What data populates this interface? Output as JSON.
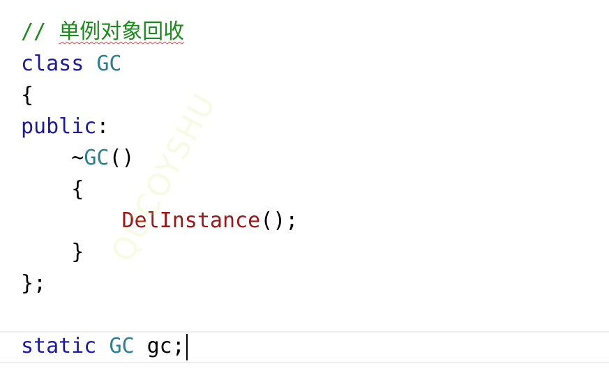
{
  "colors": {
    "comment": "#1a8c1a",
    "keyword": "#1a1aa6",
    "type": "#2b7f8f",
    "function_call": "#a31515",
    "plain": "#000000",
    "watermark": "#d9ec6a",
    "current_line_border": "#eeeef2",
    "spell_squiggle": "#e04848"
  },
  "code": {
    "comment_slashes": "//",
    "comment_text": "单例对象回收",
    "class_keyword": "class",
    "class_name": "GC",
    "open_brace": "{",
    "access_specifier": "public",
    "access_colon": ":",
    "destructor_tilde": "~",
    "destructor_name": "GC",
    "destructor_parens": "()",
    "inner_open_brace": "{",
    "call_name": "DelInstance",
    "call_suffix": "();",
    "inner_close_brace": "}",
    "close_brace": "};",
    "static_keyword": "static",
    "var_type": "GC",
    "var_name": "gc;"
  },
  "watermark": {
    "text": "QUCOYSHU"
  }
}
